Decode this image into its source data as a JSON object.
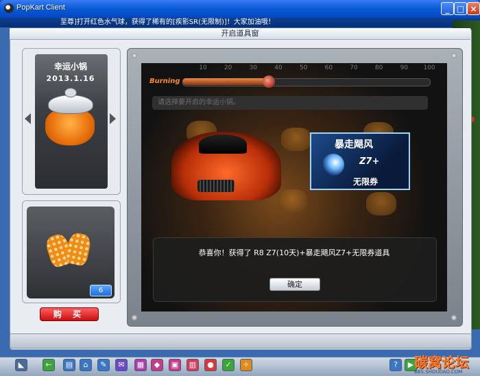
{
  "window": {
    "title": "PopKart Client"
  },
  "marquee": {
    "text": "至尊]打开红色水气球，获得了稀有的[疾影SR(无限制)]！大家加油哦！"
  },
  "panel": {
    "title": "开启道具窗"
  },
  "item_card": {
    "name": "幸运小锅",
    "date": "2013.1.16"
  },
  "shop_item": {
    "quantity": "6",
    "buy_label": "购 买"
  },
  "gauge": {
    "label": "Burning",
    "ticks": [
      "10",
      "20",
      "30",
      "40",
      "50",
      "60",
      "70",
      "80",
      "90",
      "100"
    ],
    "level_percent": 35
  },
  "prompt": {
    "text": "请选择要开启的幸运小锅。"
  },
  "reward_ticket": {
    "title": "暴走飓风",
    "model": "Z7+",
    "subtitle": "无限券"
  },
  "dialog": {
    "message": "恭喜你！获得了 R8 Z7(10天)+暴走飓风Z7+无限券道具",
    "ok_label": "确定"
  },
  "watermark": {
    "text": "碳窝论坛",
    "url": "BBS.SHOUDAO.COM"
  },
  "colors": {
    "titlebar": "#0a5cd8",
    "accent": "#ff8a1a",
    "buy": "#c90e0e"
  }
}
